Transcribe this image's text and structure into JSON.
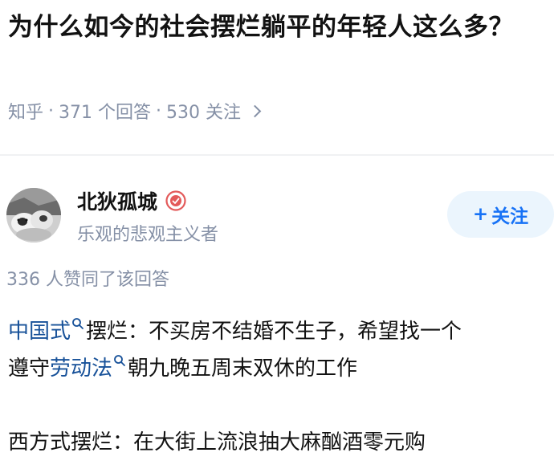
{
  "question": {
    "title": "为什么如今的社会摆烂躺平的年轻人这么多？",
    "meta": {
      "source": "知乎",
      "answers": "371 个回答",
      "followers": "530 关注"
    }
  },
  "author": {
    "name": "北狄孤城",
    "bio": "乐观的悲观主义者",
    "follow_label": "关注",
    "follow_plus": "+"
  },
  "answer": {
    "upvote_summary": "336 人赞同了该回答",
    "paragraph1": {
      "link1": "中国式",
      "text1": "摆烂：不买房不结婚不生子，希望找一个",
      "text2": "遵守",
      "link2": "劳动法",
      "text3": "朝九晚五周末双休的工作"
    },
    "paragraph2": "西方式摆烂：在大街上流浪抽大麻酗酒零元购"
  },
  "colors": {
    "link": "#175199",
    "meta": "#8590a6",
    "follow_bg": "#ebf5fd",
    "follow_text": "#1772f6",
    "badge": "#e35a5a"
  },
  "icons": {
    "meta_chevron": "chevron-right-icon",
    "badge": "creator-badge-icon",
    "search": "search-icon"
  }
}
